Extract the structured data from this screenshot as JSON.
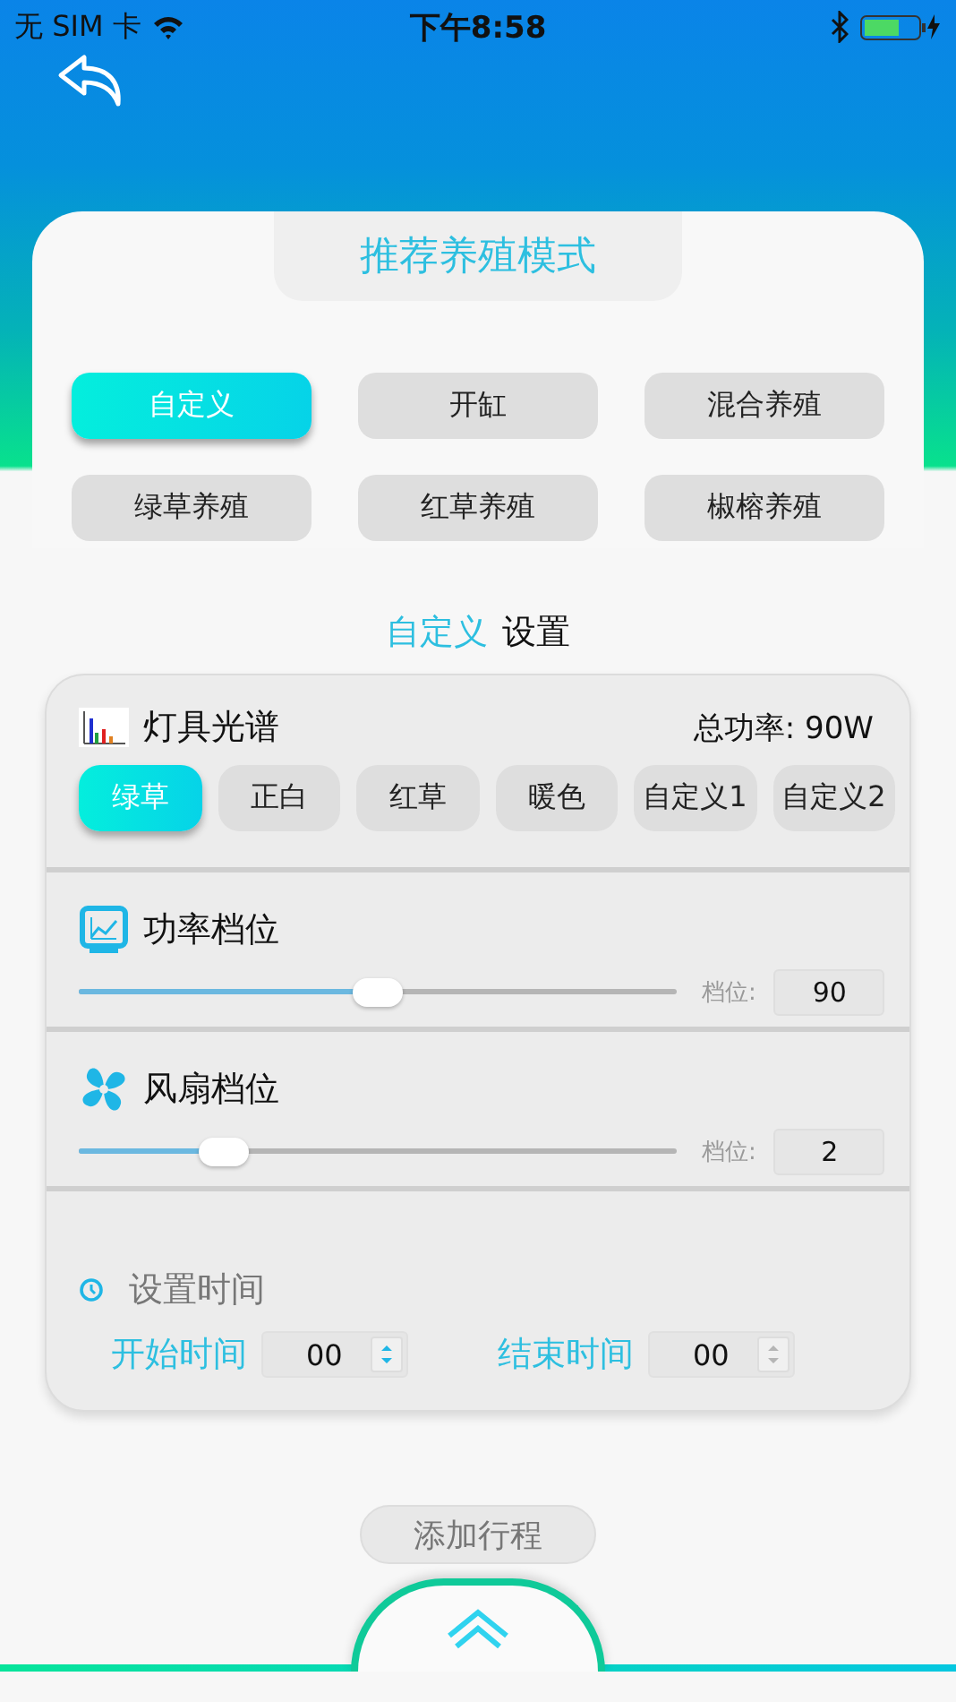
{
  "status_bar": {
    "carrier": "无 SIM 卡",
    "time": "下午8:58"
  },
  "modes": {
    "title": "推荐养殖模式",
    "items": [
      {
        "label": "自定义",
        "selected": true
      },
      {
        "label": "开缸",
        "selected": false
      },
      {
        "label": "混合养殖",
        "selected": false
      },
      {
        "label": "绿草养殖",
        "selected": false
      },
      {
        "label": "红草养殖",
        "selected": false
      },
      {
        "label": "椒榕养殖",
        "selected": false
      }
    ]
  },
  "settings_heading": {
    "mode": "自定义",
    "suffix": "设置"
  },
  "spectrum": {
    "title": "灯具光谱",
    "total_power": "总功率: 90W",
    "presets": [
      {
        "label": "绿草",
        "selected": true
      },
      {
        "label": "正白",
        "selected": false
      },
      {
        "label": "红草",
        "selected": false
      },
      {
        "label": "暖色",
        "selected": false
      },
      {
        "label": "自定义1",
        "selected": false
      },
      {
        "label": "自定义2",
        "selected": false
      }
    ]
  },
  "sliders": [
    {
      "kind": "power",
      "title": "功率档位",
      "level": 0.5,
      "label": "档位:",
      "value": "90"
    },
    {
      "kind": "fan",
      "title": "风扇档位",
      "level": 0.22,
      "label": "档位:",
      "value": "2"
    }
  ],
  "schedule": {
    "title": "设置时间",
    "fields": [
      {
        "label": "开始时间",
        "value": "00",
        "disabled": false
      },
      {
        "label": "结束时间",
        "value": "00",
        "disabled": true
      }
    ]
  },
  "add_button": "添加行程"
}
